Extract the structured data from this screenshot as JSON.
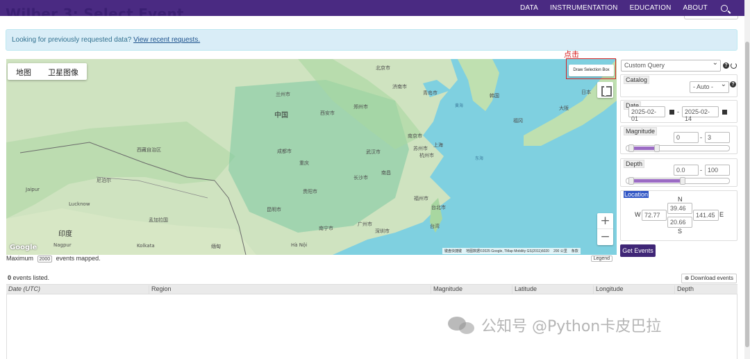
{
  "header": {
    "page_title": "Wilber 3: Select Event",
    "nav": [
      "DATA",
      "INSTRUMENTATION",
      "EDUCATION",
      "ABOUT"
    ]
  },
  "banner": {
    "text": "Looking for previously requested data?",
    "link": "View recent requests."
  },
  "map": {
    "type_tabs": [
      "地图",
      "卫星图像"
    ],
    "draw_box_label": "Draw Selection Box",
    "zoom_in": "+",
    "zoom_out": "−",
    "google": "Google",
    "attribution": [
      "键盘快捷键",
      "地图数据©2025 Google, TMap Mobility GS(2011)6020",
      "200 公里",
      "条款"
    ],
    "labels": {
      "china": "中国",
      "india": "印度",
      "korea": "韩国",
      "japan": "日本",
      "beijing": "北京市",
      "shanghai": "上海",
      "wuhan": "武汉市",
      "chengdu": "成都市",
      "chongqing": "重庆",
      "kunming": "昆明市",
      "taipei": "台北市",
      "taiwan": "台湾",
      "shenzhen": "深圳市",
      "hanoi": "Hà Nội",
      "nepal": "尼泊尔",
      "bangladesh": "孟加拉国",
      "myanmar": "缅甸",
      "jaipur": "Jaipur",
      "lucknow": "Lucknow",
      "kolkata": "Kolkata",
      "nagpur": "Nagpur",
      "tibet": "西藏自治区",
      "yellow_sea": "黄海",
      "east_sea": "东海",
      "osaka": "大阪",
      "fukuoka": "福冈",
      "nanjing": "南京市",
      "suzhou": "苏州市",
      "hangzhou": "杭州市",
      "qingdao": "青岛市",
      "jinan": "济南市",
      "zhengzhou": "郑州市",
      "xian": "西安市",
      "lanzhou": "兰州市",
      "changsha": "长沙市",
      "nanchang": "南昌",
      "fuzhou": "福州市",
      "guiyang": "贵阳市",
      "nanning": "南宁市",
      "guangzhou": "广州市",
      "annotation": "点击"
    }
  },
  "map_footer": {
    "prefix": "Maximum",
    "max_value": "2000",
    "suffix": "events mapped.",
    "legend": "Legend"
  },
  "query": {
    "selected": "Custom Query"
  },
  "catalog": {
    "label": "Catalog",
    "value": "- Auto -"
  },
  "date": {
    "label": "Date",
    "start": "2025-02-01",
    "end": "2025-02-14",
    "separator": "-"
  },
  "magnitude": {
    "label": "Magnitude",
    "min": "0",
    "max": "3",
    "separator": "-",
    "range_fraction": [
      0.05,
      0.3
    ]
  },
  "depth": {
    "label": "Depth",
    "min": "0.0",
    "max": "100",
    "separator": "-",
    "range_fraction": [
      0.05,
      0.55
    ]
  },
  "location": {
    "label": "Location",
    "n_label": "N",
    "s_label": "S",
    "w_label": "W",
    "e_label": "E",
    "north": "39.46",
    "south": "20.66",
    "west": "72.77",
    "east": "141.45"
  },
  "get_events": "Get Events",
  "table": {
    "count": "0",
    "count_suffix": "events listed.",
    "download": "Download events",
    "columns": [
      "Date (UTC)",
      "Region",
      "Magnitude",
      "Latitude",
      "Longitude",
      "Depth"
    ]
  },
  "watermark": {
    "text": "公知号 @Python卡皮巴拉"
  }
}
